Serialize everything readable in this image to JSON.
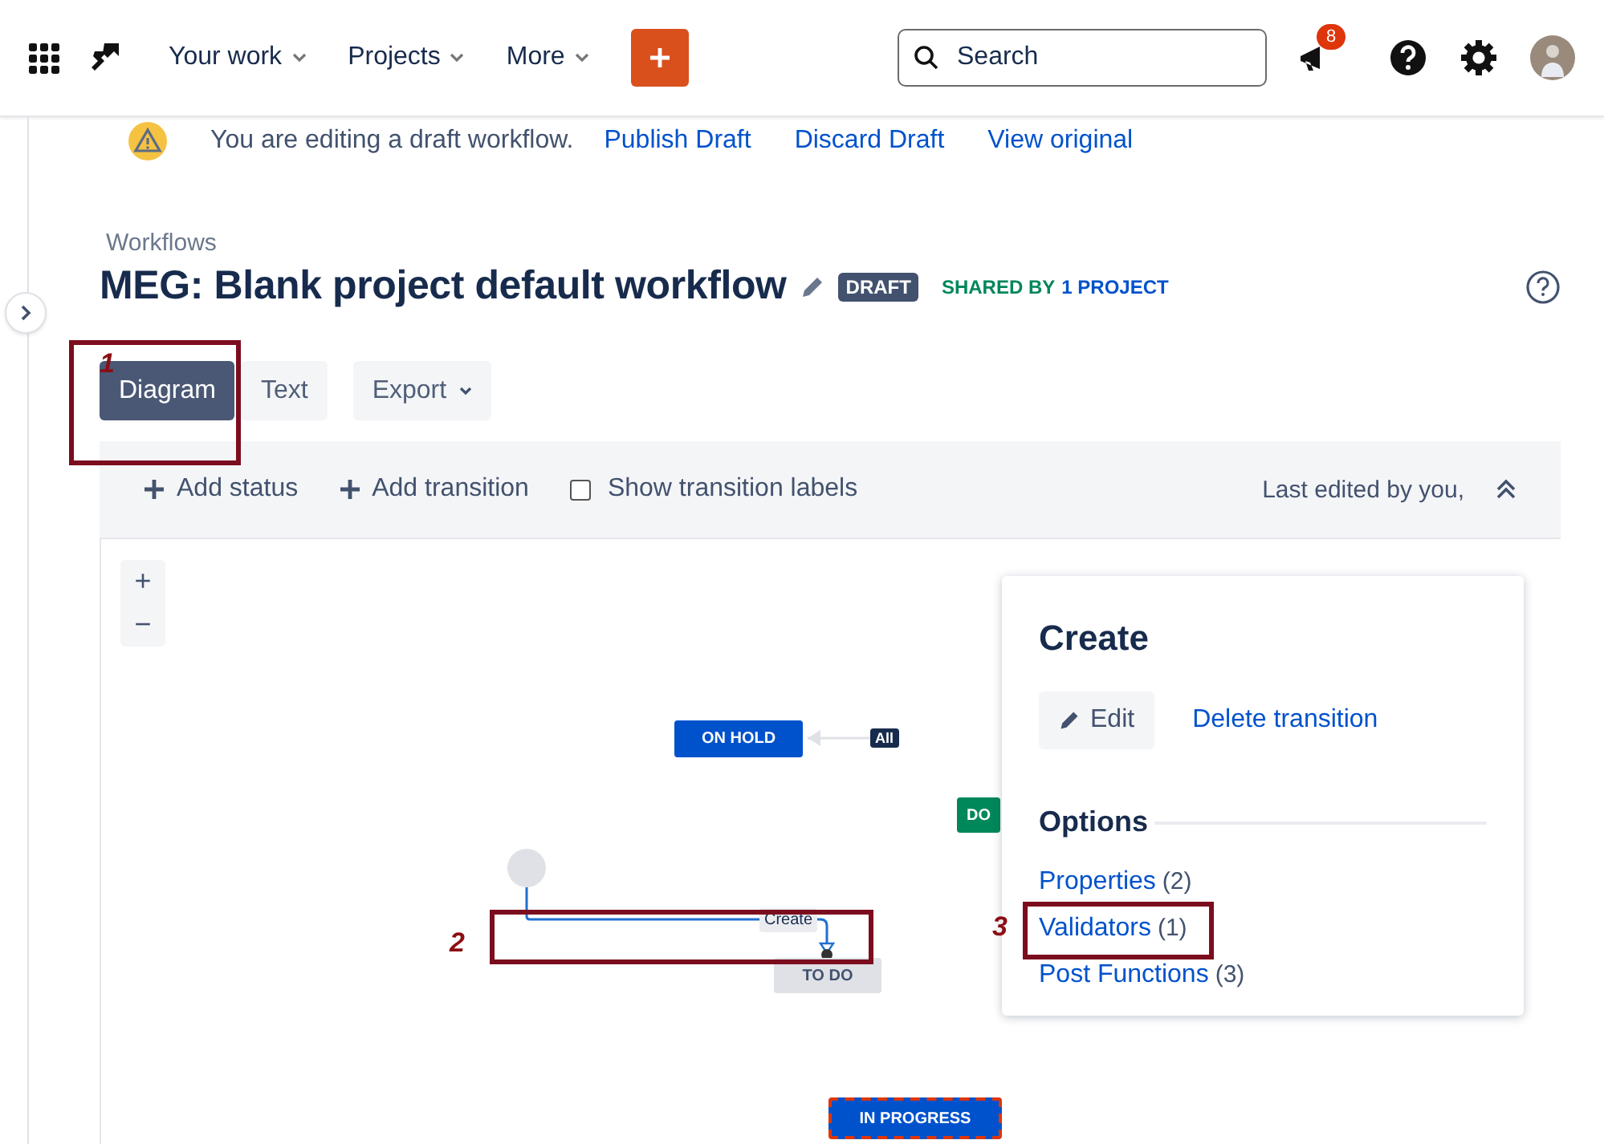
{
  "top_nav": {
    "menus": [
      {
        "label": "Your work",
        "dropdown": true
      },
      {
        "label": "Projects",
        "dropdown": true
      },
      {
        "label": "More",
        "dropdown": true
      }
    ],
    "search": {
      "placeholder": "Search"
    },
    "notification_count": "8"
  },
  "draft_banner": {
    "message": "You are editing a draft workflow.",
    "links": [
      "Publish Draft",
      "Discard Draft",
      "View original"
    ]
  },
  "breadcrumb": "Workflows",
  "title": "MEG: Blank project default workflow",
  "status_badge": "DRAFT",
  "shared": {
    "prefix": "SHARED BY",
    "link": "1 PROJECT"
  },
  "view_tabs": [
    {
      "label": "Diagram",
      "selected": true
    },
    {
      "label": "Text",
      "selected": false
    }
  ],
  "export_button": "Export",
  "toolbar": {
    "actions": [
      "Add status",
      "Add transition"
    ],
    "show_labels": {
      "label": "Show transition labels",
      "checked": false
    },
    "last_edited": "Last edited by you,"
  },
  "zoom_controls": [
    "+",
    "−"
  ],
  "diagram": {
    "nodes": [
      {
        "label": "ON HOLD",
        "kind": "status",
        "color": "#0052cc",
        "selected": false
      },
      {
        "label": "All",
        "kind": "global",
        "color": "#172b4d"
      },
      {
        "label": "DO",
        "kind": "status",
        "color": "#00875a",
        "selected": false
      },
      {
        "kind": "start",
        "color": "#dfe1e6"
      },
      {
        "label": "TO DO",
        "kind": "status",
        "color": "#dfe1e6",
        "selected": false
      },
      {
        "label": "IN PROGRESS",
        "kind": "status",
        "color": "#0052cc",
        "selected": true
      }
    ],
    "transition_label": "Create"
  },
  "transition_panel": {
    "title": "Create",
    "edit": "Edit",
    "delete": "Delete transition",
    "options_heading": "Options",
    "options": [
      {
        "label": "Properties",
        "count": "(2)"
      },
      {
        "label": "Validators",
        "count": "(1)"
      },
      {
        "label": "Post Functions",
        "count": "(3)"
      }
    ]
  },
  "annotations": [
    "1",
    "2",
    "3"
  ]
}
